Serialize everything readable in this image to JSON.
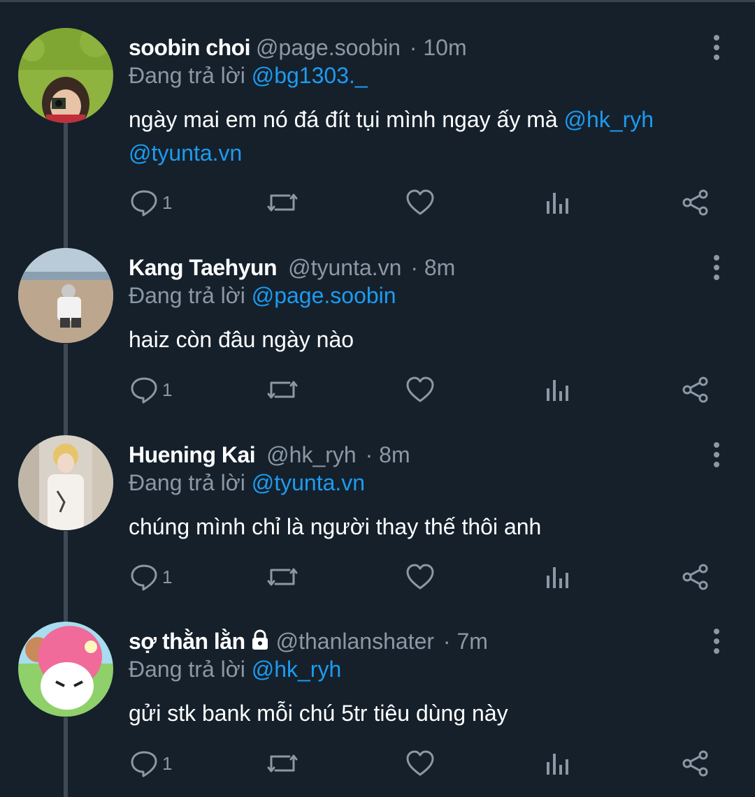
{
  "reply_prefix": "Đang trả lời",
  "colors": {
    "background": "#15202b",
    "text": "#ffffff",
    "muted": "#8b98a5",
    "mention": "#1d9bf0"
  },
  "tweets": [
    {
      "name": "soobin choi",
      "handle": "@page.soobin",
      "time": "· 10m",
      "reply_to": "@bg1303._",
      "text_line1": "ngày mai em nó đá đít tụi mình ngay ấy mà",
      "mention1": "@hk_ryh",
      "mention2": "@tyunta.vn",
      "reply_count": "1",
      "locked": false
    },
    {
      "name": "Kang Taehyun",
      "handle": "@tyunta.vn",
      "time": "· 8m",
      "reply_to": "@page.soobin",
      "text": "haiz còn đâu ngày nào",
      "reply_count": "1",
      "locked": false
    },
    {
      "name": "Huening Kai",
      "handle": "@hk_ryh",
      "time": "· 8m",
      "reply_to": "@tyunta.vn",
      "text": "chúng mình chỉ là người thay thế thôi anh",
      "reply_count": "1",
      "locked": false
    },
    {
      "name": "sợ thằn lằn",
      "handle": "@thanlanshater",
      "time": "· 7m",
      "reply_to": "@hk_ryh",
      "text": "gửi stk bank mỗi chú 5tr tiêu dùng này",
      "reply_count": "1",
      "locked": true
    }
  ],
  "icons": [
    "reply-icon",
    "retweet-icon",
    "like-icon",
    "analytics-icon",
    "share-icon",
    "more-icon",
    "lock-icon"
  ]
}
